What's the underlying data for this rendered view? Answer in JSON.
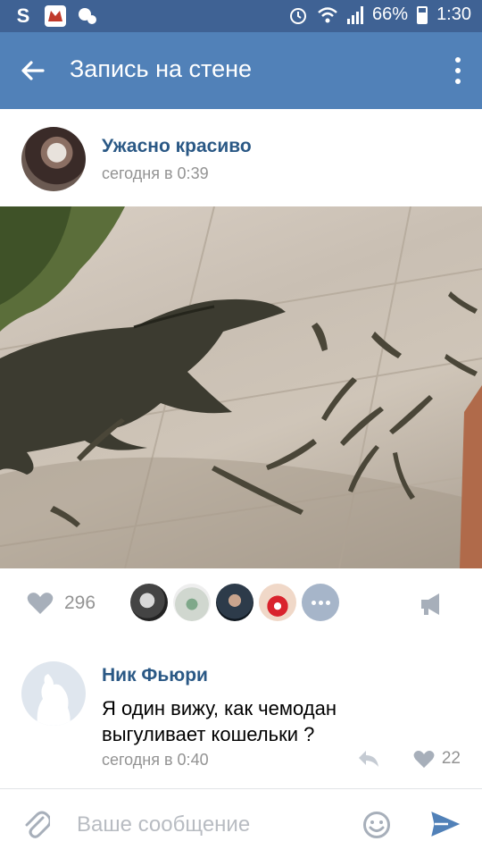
{
  "statusbar": {
    "battery": "66%",
    "time": "1:30",
    "icons": [
      "vk-s-icon",
      "app-notification-icon",
      "weather-icon",
      "alarm-icon",
      "wifi-icon",
      "signal-icon",
      "battery-icon"
    ]
  },
  "appbar": {
    "title": "Запись на стене",
    "back_icon": "arrow-left-icon",
    "more_icon": "more-vertical-icon"
  },
  "post": {
    "author": "Ужасно красиво",
    "time": "сегодня в 0:39",
    "photo_subject": "photo"
  },
  "actions": {
    "like_count": "296",
    "likers_count_shown": 4,
    "share_icon": "megaphone-icon"
  },
  "comment": {
    "author": "Ник Фьюри",
    "text": "Я один вижу, как чемодан выгуливает кошельки ?",
    "time": "сегодня в 0:40",
    "like_count": "22"
  },
  "composer": {
    "placeholder": "Ваше сообщение"
  },
  "colors": {
    "statusbar": "#3f6294",
    "appbar": "#5181b8",
    "link": "#2a5885",
    "muted": "#939393",
    "send": "#5181b8"
  }
}
